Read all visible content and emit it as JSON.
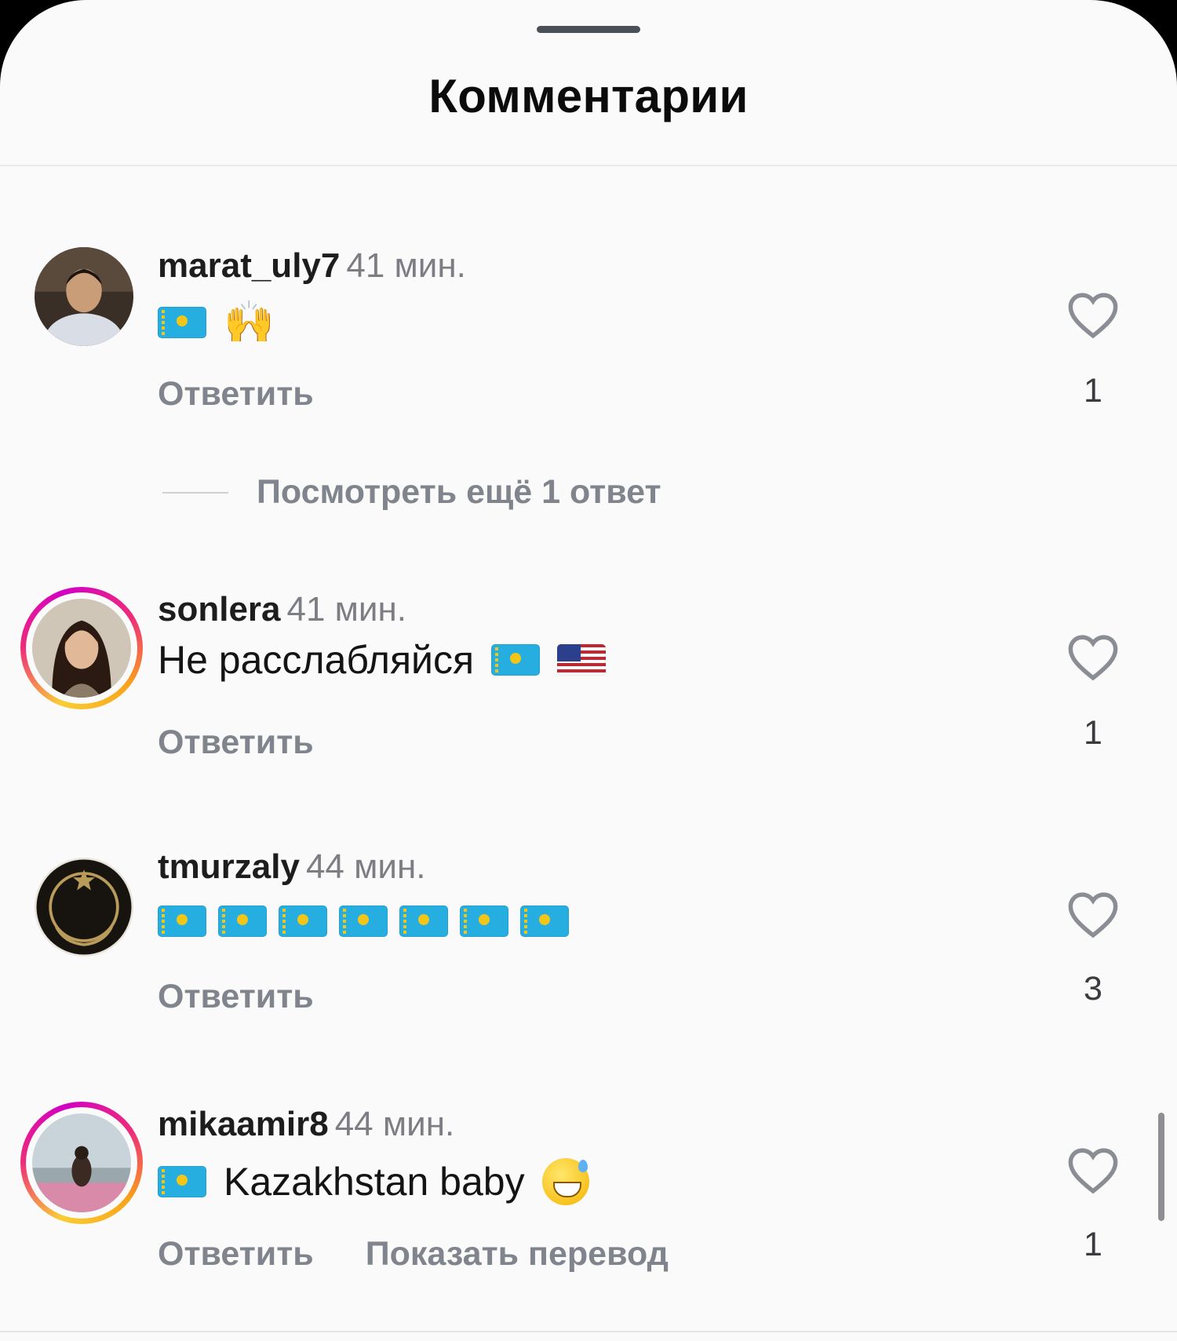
{
  "sheet": {
    "title": "Комментарии"
  },
  "view_more_replies": "Посмотреть ещё 1 ответ",
  "comments": [
    {
      "username": "marat_uly7",
      "time": "41 мин.",
      "text": "",
      "emoji": [
        "flag-kazakhstan",
        "raising-hands"
      ],
      "reply_label": "Ответить",
      "likes": "1",
      "story_ring": false
    },
    {
      "username": "sonlera",
      "time": "41 мин.",
      "text": "Не расслабляйся",
      "emoji": [
        "flag-kazakhstan",
        "flag-united-states"
      ],
      "reply_label": "Ответить",
      "likes": "1",
      "story_ring": true
    },
    {
      "username": "tmurzaly",
      "time": "44 мин.",
      "text": "",
      "emoji": [
        "flag-kazakhstan",
        "flag-kazakhstan",
        "flag-kazakhstan",
        "flag-kazakhstan",
        "flag-kazakhstan",
        "flag-kazakhstan",
        "flag-kazakhstan"
      ],
      "reply_label": "Ответить",
      "likes": "3",
      "story_ring": false
    },
    {
      "username": "mikaamir8",
      "time": "44 мин.",
      "text": "Kazakhstan baby",
      "emoji": [
        "flag-kazakhstan",
        "grinning-face-with-sweat"
      ],
      "reply_label": "Ответить",
      "translate_label": "Показать перевод",
      "likes": "1",
      "story_ring": true
    }
  ],
  "colors": {
    "background": "#fafafa",
    "username": "#1d1d1d",
    "secondary_text": "#80848c",
    "story_ring_start": "#f9ce34",
    "story_ring_mid": "#ee2a7b",
    "flag_kazakhstan": "#27aee0"
  },
  "icons": {
    "like": "heart-outline-icon"
  }
}
